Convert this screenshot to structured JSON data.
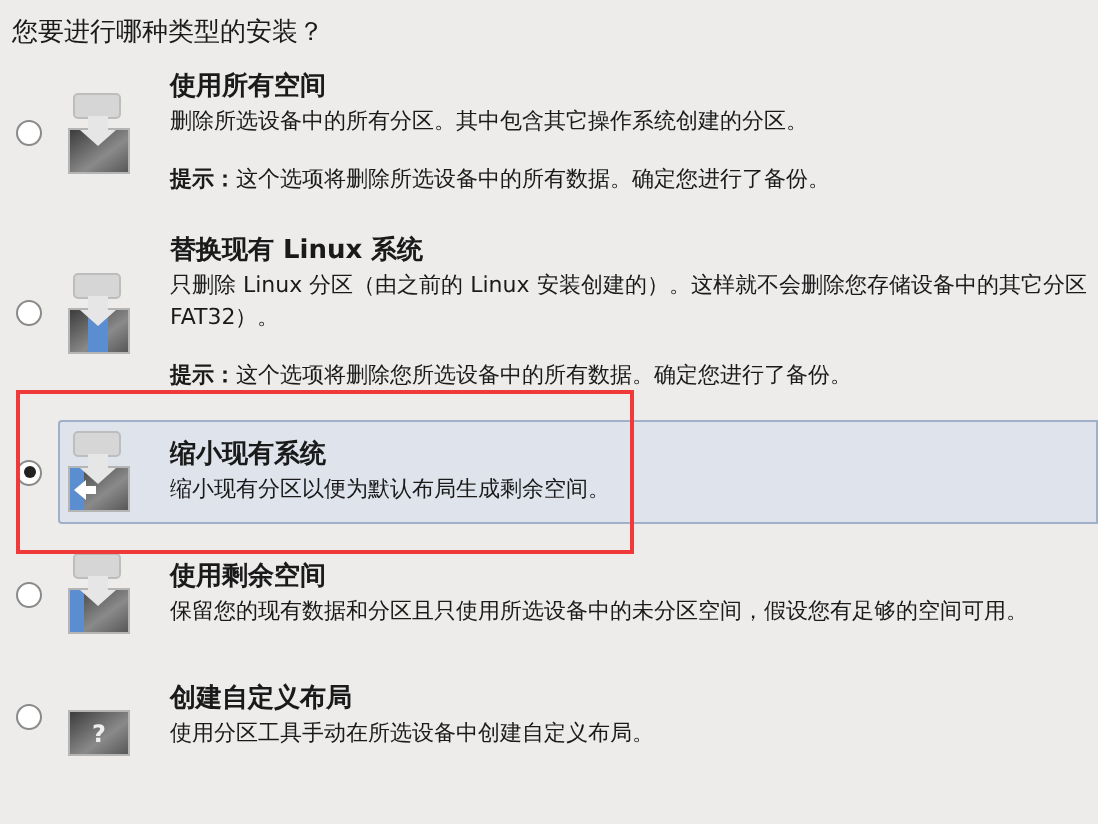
{
  "question": "您要进行哪种类型的安装？",
  "options": [
    {
      "kind": "erase",
      "title": "使用所有空间",
      "description": [
        "删除所选设备中的所有分区。其中包含其它操作系统创建的分区。"
      ],
      "hint_label": "提示：",
      "hint": "这个选项将删除所选设备中的所有数据。确定您进行了备份。",
      "selected": false
    },
    {
      "kind": "replace",
      "title": "替换现有 Linux 系统",
      "description": [
        "只删除 Linux 分区（由之前的 Linux 安装创建的）。这样就不会删除您存储设备中的其它分区",
        "FAT32）。"
      ],
      "hint_label": "提示：",
      "hint": "这个选项将删除您所选设备中的所有数据。确定您进行了备份。",
      "selected": false
    },
    {
      "kind": "shrink",
      "title": "缩小现有系统",
      "description": [
        "缩小现有分区以便为默认布局生成剩余空间。"
      ],
      "selected": true
    },
    {
      "kind": "free",
      "title": "使用剩余空间",
      "description": [
        "保留您的现有数据和分区且只使用所选设备中的未分区空间，假设您有足够的空间可用。"
      ],
      "selected": false
    },
    {
      "kind": "custom",
      "title": "创建自定义布局",
      "description": [
        "使用分区工具手动在所选设备中创建自定义布局。"
      ],
      "icon_label": "?",
      "selected": false
    }
  ],
  "annotation": {
    "kind": "rectangle",
    "color": "#f03a3a"
  }
}
